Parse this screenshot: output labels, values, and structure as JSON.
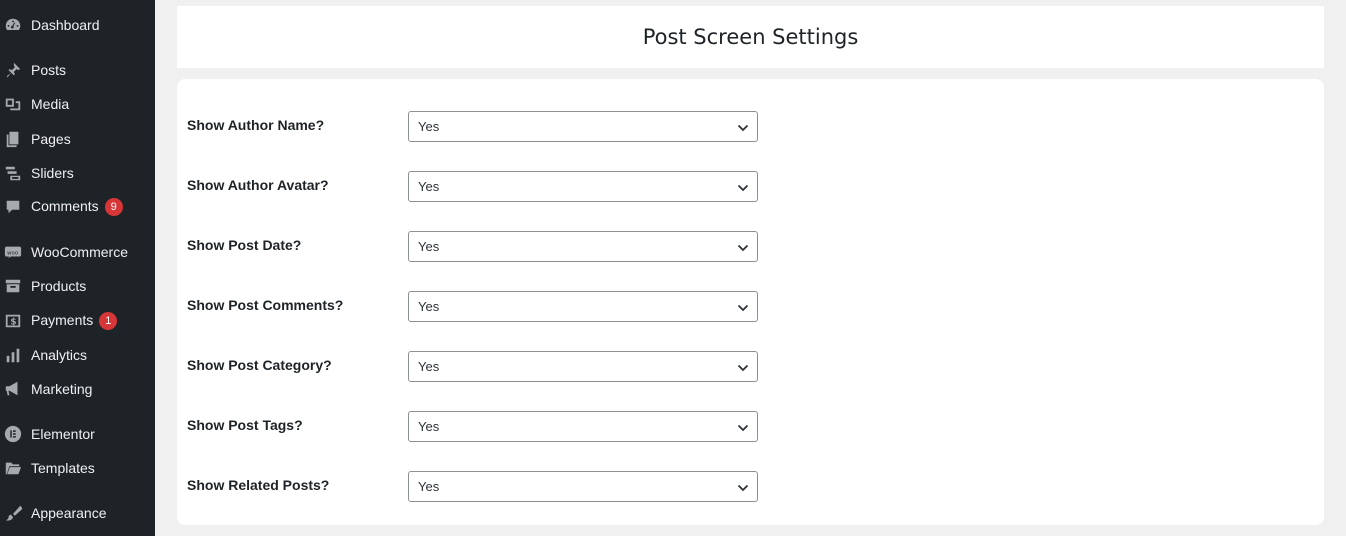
{
  "sidebar": {
    "items": [
      {
        "label": "Dashboard",
        "icon": "dashboard-icon"
      },
      {
        "label": "Posts",
        "icon": "pin-icon"
      },
      {
        "label": "Media",
        "icon": "media-icon"
      },
      {
        "label": "Pages",
        "icon": "pages-icon"
      },
      {
        "label": "Sliders",
        "icon": "sliders-icon"
      },
      {
        "label": "Comments",
        "icon": "comment-icon",
        "badge": "9"
      },
      {
        "label": "WooCommerce",
        "icon": "woo-icon"
      },
      {
        "label": "Products",
        "icon": "archive-icon"
      },
      {
        "label": "Payments",
        "icon": "dollar-icon",
        "badge": "1"
      },
      {
        "label": "Analytics",
        "icon": "bar-chart-icon"
      },
      {
        "label": "Marketing",
        "icon": "megaphone-icon"
      },
      {
        "label": "Elementor",
        "icon": "elementor-icon"
      },
      {
        "label": "Templates",
        "icon": "folder-icon"
      },
      {
        "label": "Appearance",
        "icon": "brush-icon"
      }
    ]
  },
  "main": {
    "title": "Post Screen Settings",
    "settings": [
      {
        "label": "Show Author Name?",
        "value": "Yes"
      },
      {
        "label": "Show Author Avatar?",
        "value": "Yes"
      },
      {
        "label": "Show Post Date?",
        "value": "Yes"
      },
      {
        "label": "Show Post Comments?",
        "value": "Yes"
      },
      {
        "label": "Show Post Category?",
        "value": "Yes"
      },
      {
        "label": "Show Post Tags?",
        "value": "Yes"
      },
      {
        "label": "Show Related Posts?",
        "value": "Yes"
      }
    ]
  },
  "colors": {
    "sidebar_bg": "#1d2327",
    "badge": "#d63638",
    "page_bg": "#f0f0f1"
  }
}
